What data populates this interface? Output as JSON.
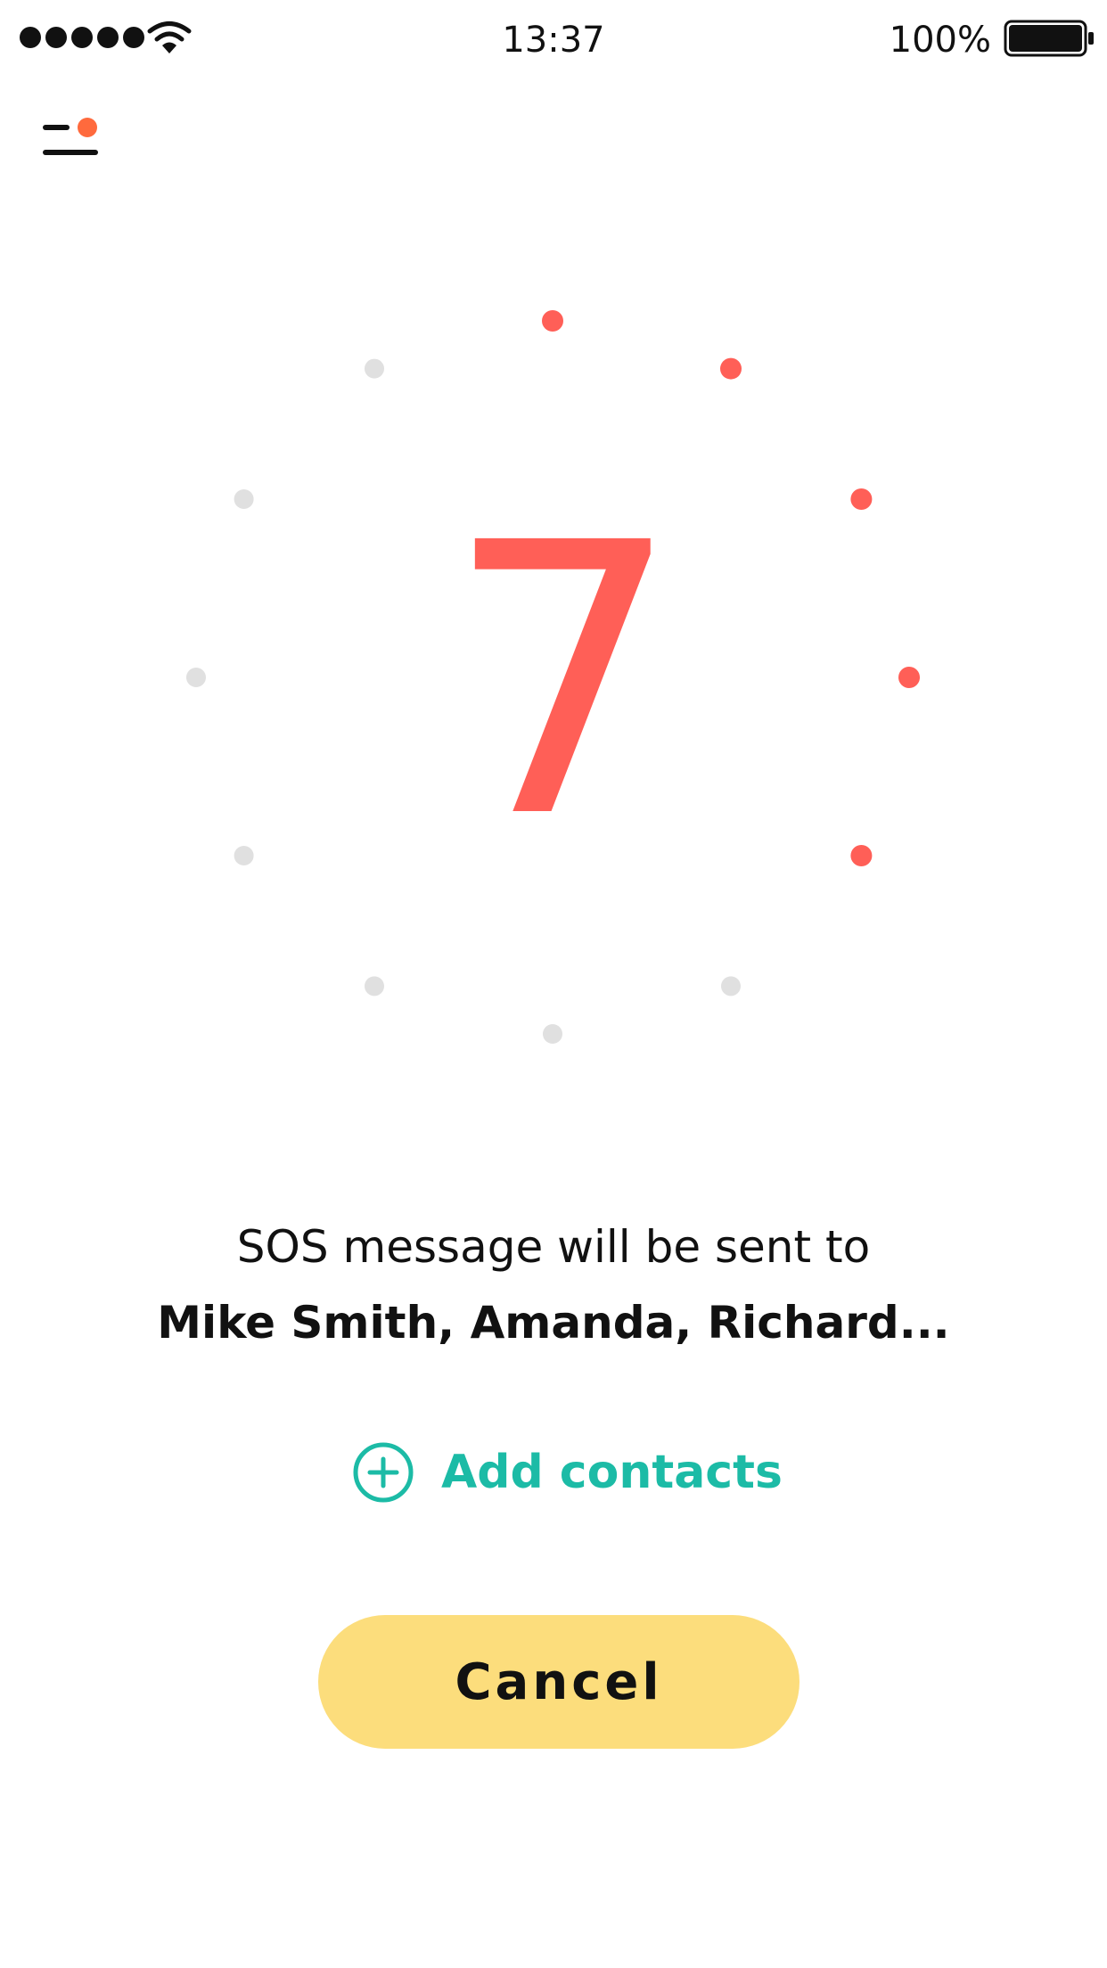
{
  "status_bar": {
    "time": "13:37",
    "battery": "100%"
  },
  "countdown": {
    "value": "7",
    "total_dots": 12,
    "active_dots": 5,
    "active_color": "#ff5f57",
    "inactive_color": "#e0e0e0"
  },
  "message": {
    "line1": "SOS message will be sent to",
    "recipients": "Mike Smith, Amanda, Richard..."
  },
  "add_contacts": {
    "label": "Add contacts",
    "color": "#1cbba6"
  },
  "cancel": {
    "label": "Cancel",
    "color": "#fcdd7c"
  },
  "menu": {
    "badge_color": "#ff6a3d"
  },
  "icons": [
    "signal-icon",
    "wifi-icon",
    "battery-icon",
    "menu-icon",
    "plus-circle-icon"
  ]
}
